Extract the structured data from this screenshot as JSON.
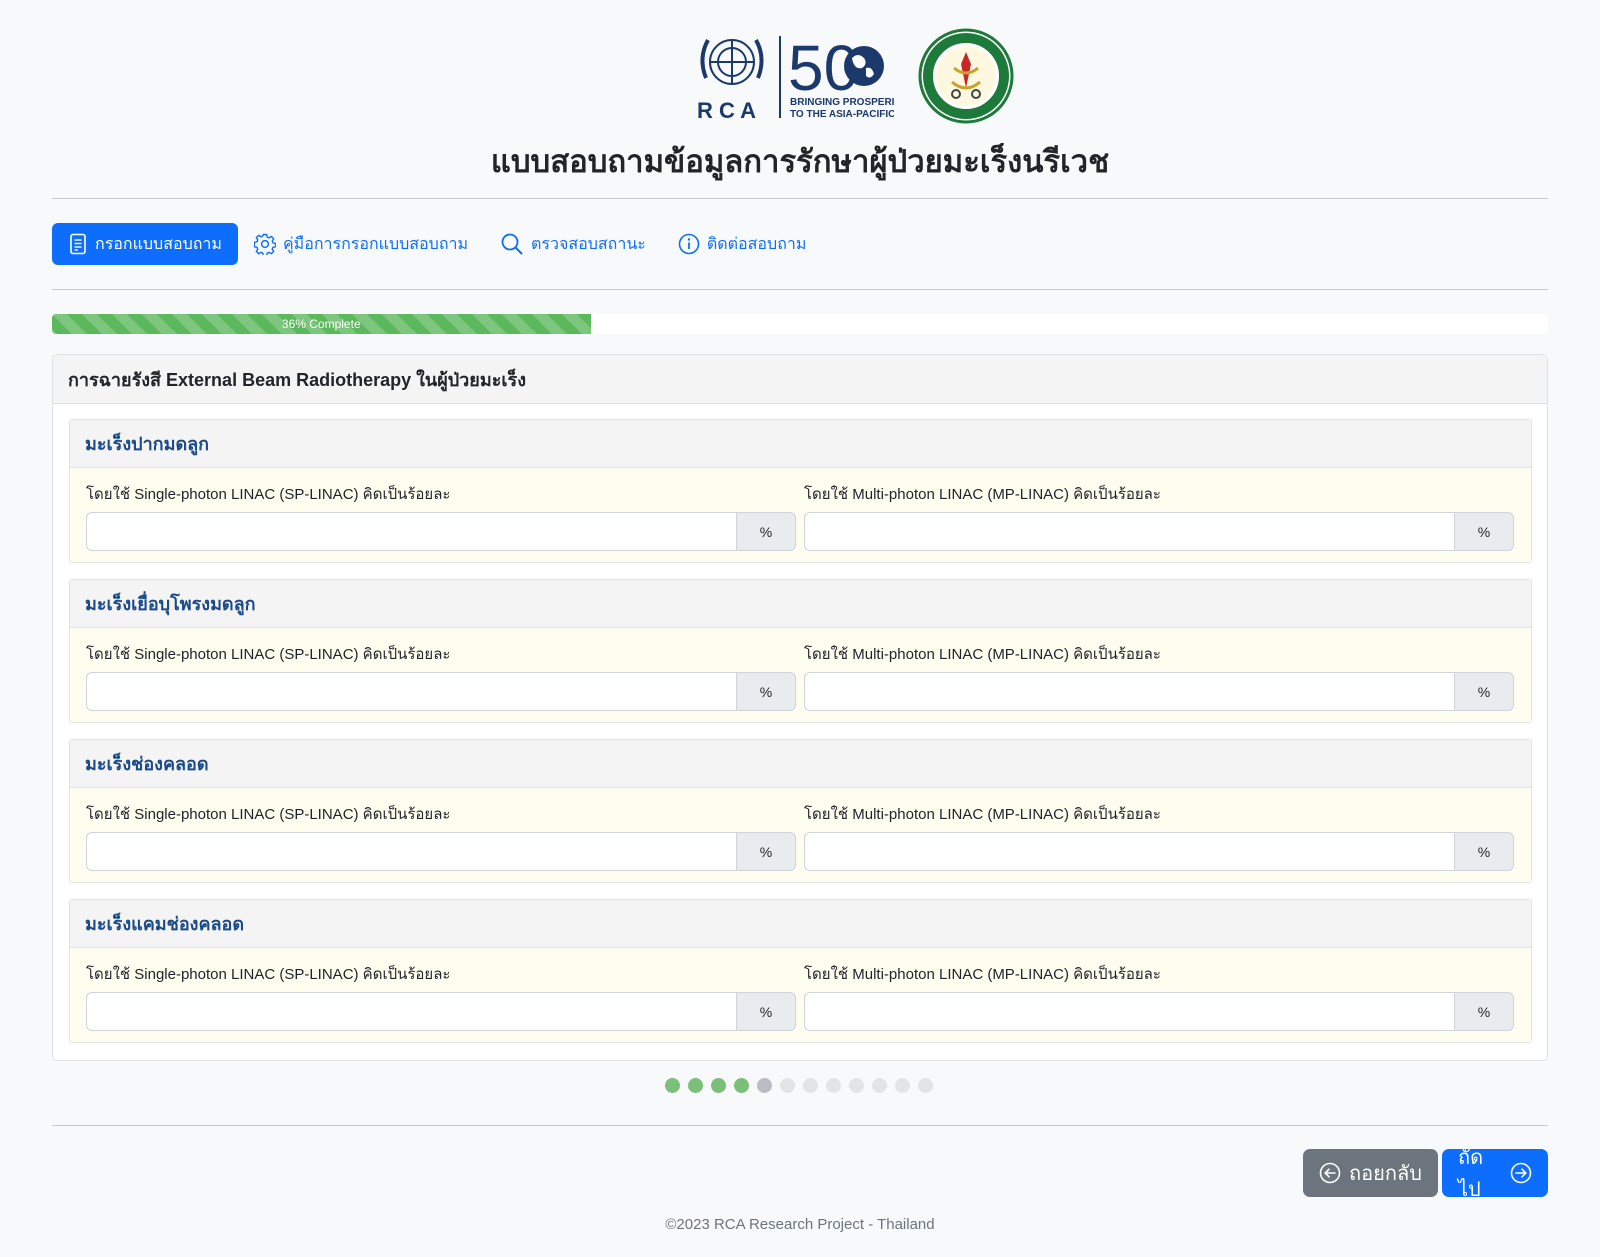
{
  "header": {
    "rca_letters": "R C A",
    "rca_fifty": "50",
    "rca_tagline_1": "BRINGING PROSPERITY",
    "rca_tagline_2": "TO THE ASIA-PACIFIC",
    "title": "แบบสอบถามข้อมูลการรักษาผู้ป่วยมะเร็งนรีเวช"
  },
  "nav": {
    "items": [
      {
        "label": "กรอกแบบสอบถาม",
        "icon": "document-icon",
        "active": true
      },
      {
        "label": "คู่มือการกรอกแบบสอบถาม",
        "icon": "gear-icon",
        "active": false
      },
      {
        "label": "ตรวจสอบสถานะ",
        "icon": "search-icon",
        "active": false
      },
      {
        "label": "ติดต่อสอบถาม",
        "icon": "info-icon",
        "active": false
      }
    ]
  },
  "progress": {
    "value_percent": 36,
    "label": "36% Complete"
  },
  "card": {
    "title": "การฉายรังสี External Beam Radiotherapy ในผู้ป่วยมะเร็ง",
    "sections": [
      {
        "title": "มะเร็งปากมดลูก",
        "left_label": "โดยใช้ Single-photon LINAC (SP-LINAC) คิดเป็นร้อยละ",
        "left_value": "",
        "right_label": "โดยใช้ Multi-photon LINAC (MP-LINAC) คิดเป็นร้อยละ",
        "right_value": "",
        "unit": "%"
      },
      {
        "title": "มะเร็งเยื่อบุโพรงมดลูก",
        "left_label": "โดยใช้ Single-photon LINAC (SP-LINAC) คิดเป็นร้อยละ",
        "left_value": "",
        "right_label": "โดยใช้ Multi-photon LINAC (MP-LINAC) คิดเป็นร้อยละ",
        "right_value": "",
        "unit": "%"
      },
      {
        "title": "มะเร็งช่องคลอด",
        "left_label": "โดยใช้ Single-photon LINAC (SP-LINAC) คิดเป็นร้อยละ",
        "left_value": "",
        "right_label": "โดยใช้ Multi-photon LINAC (MP-LINAC) คิดเป็นร้อยละ",
        "right_value": "",
        "unit": "%"
      },
      {
        "title": "มะเร็งแคมช่องคลอด",
        "left_label": "โดยใช้ Single-photon LINAC (SP-LINAC) คิดเป็นร้อยละ",
        "left_value": "",
        "right_label": "โดยใช้ Multi-photon LINAC (MP-LINAC) คิดเป็นร้อยละ",
        "right_value": "",
        "unit": "%"
      }
    ]
  },
  "pagination": {
    "total": 12,
    "completed": 4,
    "current": 5
  },
  "buttons": {
    "back_label": "ถอยกลับ",
    "next_label": "ถัดไป"
  },
  "footer": {
    "text": "©2023 RCA Research Project - Thailand"
  },
  "colors": {
    "primary": "#0d6efd",
    "secondary": "#6c757d",
    "progress": "#5cb85c",
    "section_title": "#1a4a8a",
    "section_body": "#fffdf0"
  }
}
